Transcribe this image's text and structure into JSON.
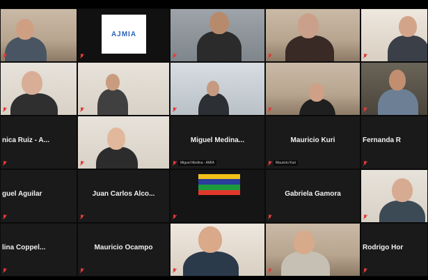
{
  "participants": [
    {
      "kind": "video",
      "label": "",
      "scene": "wall-warm",
      "cut": false
    },
    {
      "kind": "logo",
      "label": "",
      "logo": "AJMIA"
    },
    {
      "kind": "video",
      "label": "",
      "scene": "wall-gray",
      "cut": false
    },
    {
      "kind": "video",
      "label": "",
      "scene": "wall-warm",
      "cut": false
    },
    {
      "kind": "video",
      "label": "",
      "scene": "wall-cream",
      "cut": false
    },
    {
      "kind": "video",
      "label": "",
      "scene": "wall-light",
      "cut": false
    },
    {
      "kind": "video",
      "label": "",
      "scene": "wall-light",
      "cut": false
    },
    {
      "kind": "video",
      "label": "",
      "scene": "wall-office",
      "cut": false
    },
    {
      "kind": "video",
      "label": "",
      "scene": "wall-warm",
      "cut": false
    },
    {
      "kind": "video",
      "label": "",
      "scene": "wall-dark",
      "cut": false
    },
    {
      "kind": "name",
      "name": "nica Ruiz - A...",
      "label": "",
      "cut": true
    },
    {
      "kind": "video",
      "label": "",
      "scene": "wall-light",
      "cut": false
    },
    {
      "kind": "name",
      "name": "Miguel Medina...",
      "label": "Miguel Medina - AMIA",
      "cut": false
    },
    {
      "kind": "name",
      "name": "Mauricio Kuri",
      "label": "Mauricio Kuri",
      "cut": false
    },
    {
      "kind": "name",
      "name": "Fernanda R",
      "label": "",
      "cut": true
    },
    {
      "kind": "name",
      "name": "guel Aguilar",
      "label": "",
      "cut": true
    },
    {
      "kind": "name",
      "name": "Juan Carlos Alco...",
      "label": "",
      "cut": false
    },
    {
      "kind": "flag",
      "label": "",
      "cut": false
    },
    {
      "kind": "name",
      "name": "Gabriela Gamora",
      "label": "",
      "cut": false
    },
    {
      "kind": "video",
      "label": "",
      "scene": "wall-light",
      "cut": false
    },
    {
      "kind": "name",
      "name": "lina Coppel...",
      "label": "",
      "cut": true
    },
    {
      "kind": "name",
      "name": "Mauricio Ocampo",
      "label": "",
      "cut": false
    },
    {
      "kind": "video",
      "label": "",
      "scene": "wall-cream",
      "cut": false
    },
    {
      "kind": "video",
      "label": "",
      "scene": "wall-warm",
      "cut": false
    },
    {
      "kind": "name",
      "name": "Rodrigo Hor",
      "label": "",
      "cut": true
    }
  ]
}
